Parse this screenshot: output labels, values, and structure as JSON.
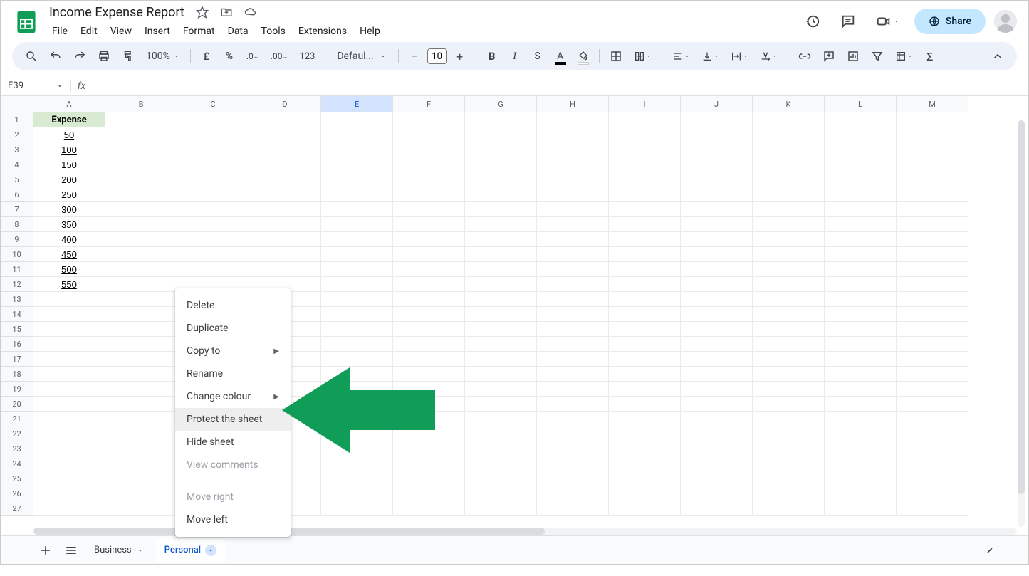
{
  "doc_title": "Income Expense Report",
  "menu": [
    "File",
    "Edit",
    "View",
    "Insert",
    "Format",
    "Data",
    "Tools",
    "Extensions",
    "Help"
  ],
  "share_label": "Share",
  "toolbar": {
    "zoom": "100%",
    "font": "Defaul...",
    "font_size": "10",
    "currency_symbol": "£",
    "percent_label": "%",
    "number_format": "123"
  },
  "name_box": "E39",
  "fx_label": "fx",
  "columns": [
    "A",
    "B",
    "C",
    "D",
    "E",
    "F",
    "G",
    "H",
    "I",
    "J",
    "K",
    "L",
    "M"
  ],
  "selected_col": "E",
  "rows": [
    {
      "n": 1,
      "a": "Expense",
      "header": true
    },
    {
      "n": 2,
      "a": "50"
    },
    {
      "n": 3,
      "a": "100"
    },
    {
      "n": 4,
      "a": "150"
    },
    {
      "n": 5,
      "a": "200"
    },
    {
      "n": 6,
      "a": "250"
    },
    {
      "n": 7,
      "a": "300"
    },
    {
      "n": 8,
      "a": "350"
    },
    {
      "n": 9,
      "a": "400"
    },
    {
      "n": 10,
      "a": "450"
    },
    {
      "n": 11,
      "a": "500"
    },
    {
      "n": 12,
      "a": "550"
    }
  ],
  "empty_row_count": 15,
  "context_menu": {
    "items": [
      {
        "label": "Delete"
      },
      {
        "label": "Duplicate"
      },
      {
        "label": "Copy to",
        "submenu": true
      },
      {
        "label": "Rename"
      },
      {
        "label": "Change colour",
        "submenu": true
      },
      {
        "label": "Protect the sheet",
        "highlighted": true
      },
      {
        "label": "Hide sheet"
      },
      {
        "label": "View comments",
        "disabled": true
      },
      {
        "divider": true
      },
      {
        "label": "Move right",
        "disabled": true
      },
      {
        "label": "Move left"
      }
    ]
  },
  "sheet_tabs": {
    "tabs": [
      {
        "name": "Business"
      },
      {
        "name": "Personal",
        "active": true
      }
    ]
  }
}
